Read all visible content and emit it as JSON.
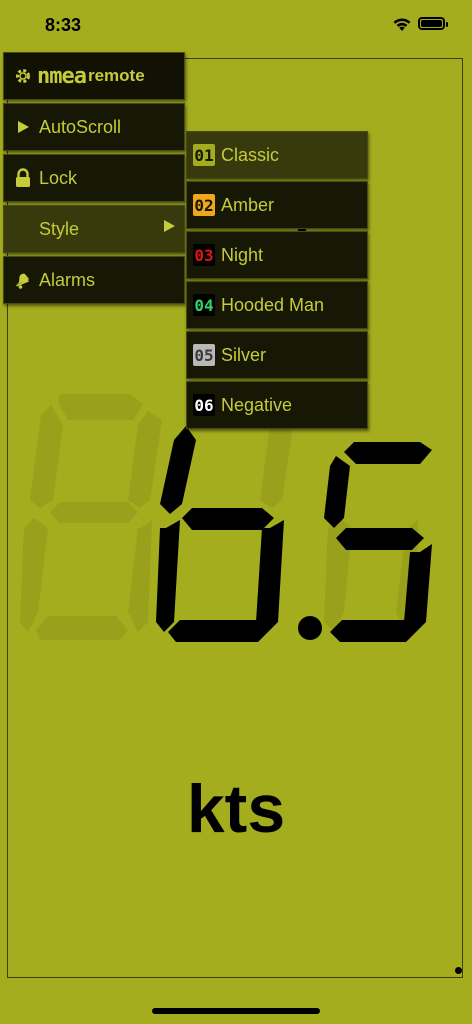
{
  "status": {
    "time": "8:33"
  },
  "menu": {
    "brand_nmea": "nmea",
    "brand_remote": "remote",
    "items": [
      {
        "label": "AutoScroll",
        "icon": "play-icon"
      },
      {
        "label": "Lock",
        "icon": "lock-icon"
      },
      {
        "label": "Style",
        "icon": "",
        "has_submenu": true,
        "active": true
      },
      {
        "label": "Alarms",
        "icon": "bell-icon"
      }
    ]
  },
  "style_submenu": {
    "items": [
      {
        "num": "01",
        "label": "Classic",
        "badge_bg": "#a4ad1e",
        "badge_fg": "#161704",
        "selected": true
      },
      {
        "num": "02",
        "label": "Amber",
        "badge_bg": "#f0a718",
        "badge_fg": "#161704",
        "selected": false
      },
      {
        "num": "03",
        "label": "Night",
        "badge_bg": "#000000",
        "badge_fg": "#e01515",
        "selected": false
      },
      {
        "num": "04",
        "label": "Hooded Man",
        "badge_bg": "#000000",
        "badge_fg": "#2dd36a",
        "selected": false
      },
      {
        "num": "05",
        "label": "Silver",
        "badge_bg": "#b9b9b9",
        "badge_fg": "#3a3a3a",
        "selected": false
      },
      {
        "num": "06",
        "label": "Negative",
        "badge_bg": "#000000",
        "badge_fg": "#ffffff",
        "selected": false
      }
    ]
  },
  "display": {
    "value": "6.5",
    "unit": "kts"
  },
  "colors": {
    "background": "#a4ad1e",
    "menu_bg": "#161704",
    "menu_text": "#c4cc3b",
    "segment_on": "#000000",
    "segment_off": "#98a01c"
  }
}
